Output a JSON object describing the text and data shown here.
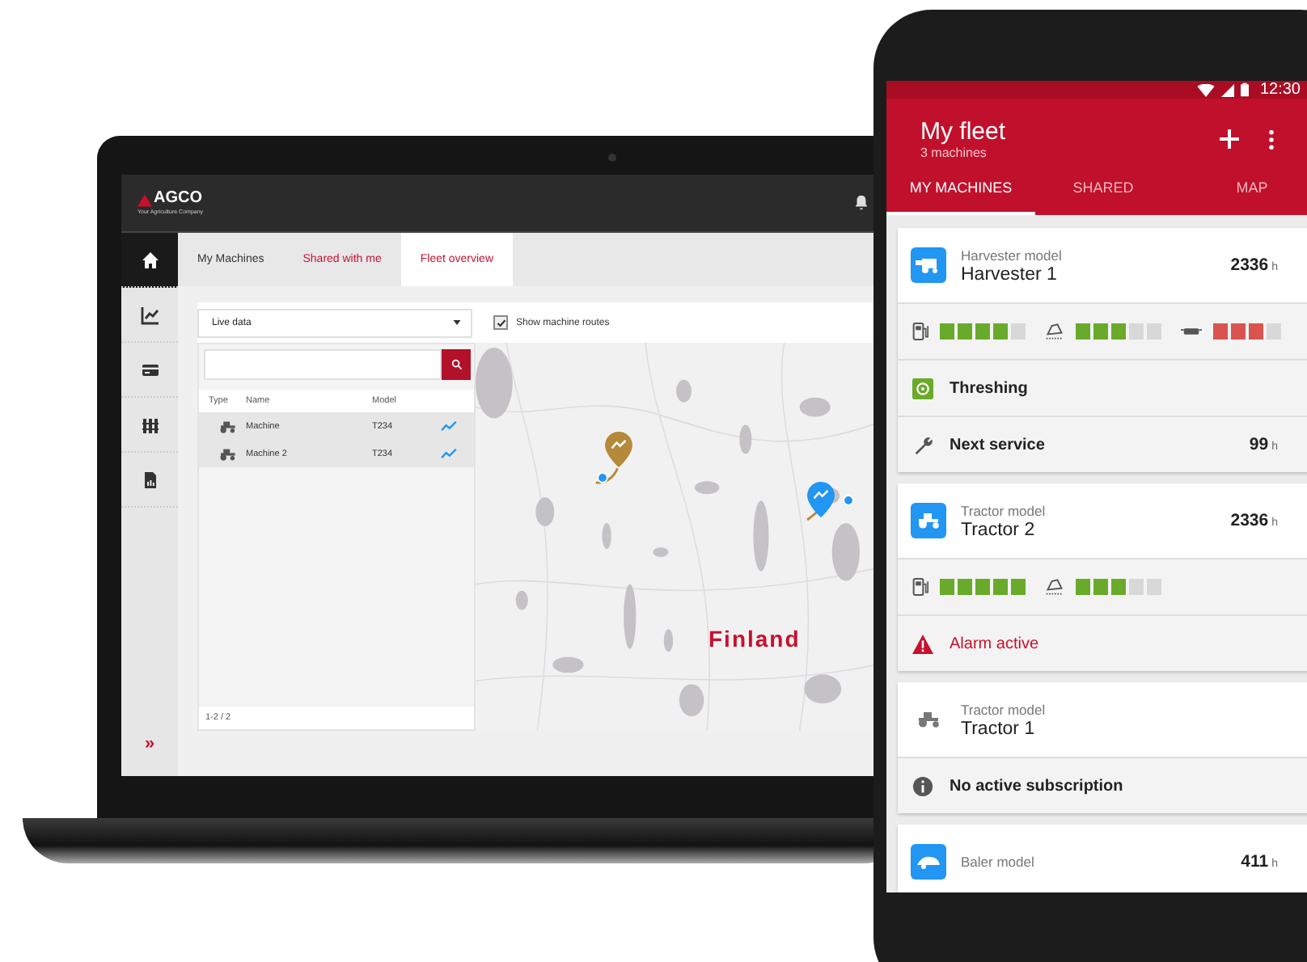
{
  "laptop": {
    "header": {
      "logo": "AGCO",
      "tagline": "Your Agriculture Company"
    },
    "sidebar": [
      {
        "kind": "home",
        "selected": true
      },
      {
        "kind": "chart",
        "selected": false
      },
      {
        "kind": "card",
        "selected": false
      },
      {
        "kind": "fence",
        "selected": false
      },
      {
        "kind": "report",
        "selected": false
      }
    ],
    "sidebar_toggle": "»",
    "tabs": [
      {
        "label": "My Machines",
        "selected": false,
        "color": "#333333"
      },
      {
        "label": "Shared with me",
        "selected": false,
        "color": "#c8102e"
      },
      {
        "label": "Fleet overview",
        "selected": true,
        "color": "#c8102e"
      }
    ],
    "data_select": {
      "value": "Live data"
    },
    "routes_checkbox": {
      "label": "Show machine routes",
      "checked": true
    },
    "machine_table": {
      "columns": [
        "Type",
        "Name",
        "Model"
      ],
      "rows": [
        {
          "name": "Machine",
          "model": "T234"
        },
        {
          "name": "Machine 2",
          "model": "T234"
        }
      ],
      "pagination": "1-2 / 2"
    },
    "map": {
      "label": "Finland",
      "pins": [
        {
          "color": "#b5893a"
        },
        {
          "color": "#2196f3"
        }
      ]
    }
  },
  "phone": {
    "time": "12:30",
    "title": "My fleet",
    "subtitle": "3 machines",
    "tabs": [
      {
        "label": "MY MACHINES",
        "selected": true
      },
      {
        "label": "SHARED",
        "selected": false
      },
      {
        "label": "MAP",
        "selected": false
      }
    ],
    "machines": [
      {
        "kind": "harvester",
        "active": true,
        "model": "Harvester model",
        "name": "Harvester 1",
        "hours": "2336",
        "unit": "h",
        "details": [
          {
            "kind": "gauges",
            "gauges": [
              {
                "kind": "fuel",
                "level": 0.8,
                "color": "#6aaa2a"
              },
              {
                "kind": "tank",
                "level": 0.6,
                "color": "#6aaa2a"
              },
              {
                "kind": "def",
                "level": 0.75,
                "color": "#d9534f"
              }
            ]
          },
          {
            "kind": "status",
            "label": "Threshing"
          },
          {
            "kind": "service",
            "label": "Next service",
            "value": "99",
            "unit": "h"
          }
        ]
      },
      {
        "kind": "tractor",
        "active": true,
        "model": "Tractor model",
        "name": "Tractor 2",
        "hours": "2336",
        "unit": "h",
        "details": [
          {
            "kind": "gauges",
            "gauges": [
              {
                "kind": "fuel",
                "level": 1,
                "color": "#6aaa2a"
              },
              {
                "kind": "tank",
                "level": 0.6,
                "color": "#6aaa2a"
              }
            ]
          },
          {
            "kind": "alarm",
            "label": "Alarm active"
          }
        ]
      },
      {
        "kind": "tractor",
        "active": false,
        "model": "Tractor model",
        "name": "Tractor 1",
        "details": [
          {
            "kind": "info",
            "label": "No active subscription"
          }
        ]
      },
      {
        "kind": "baler",
        "active": true,
        "model": "Baler model",
        "hours": "411",
        "unit": "h"
      }
    ]
  }
}
